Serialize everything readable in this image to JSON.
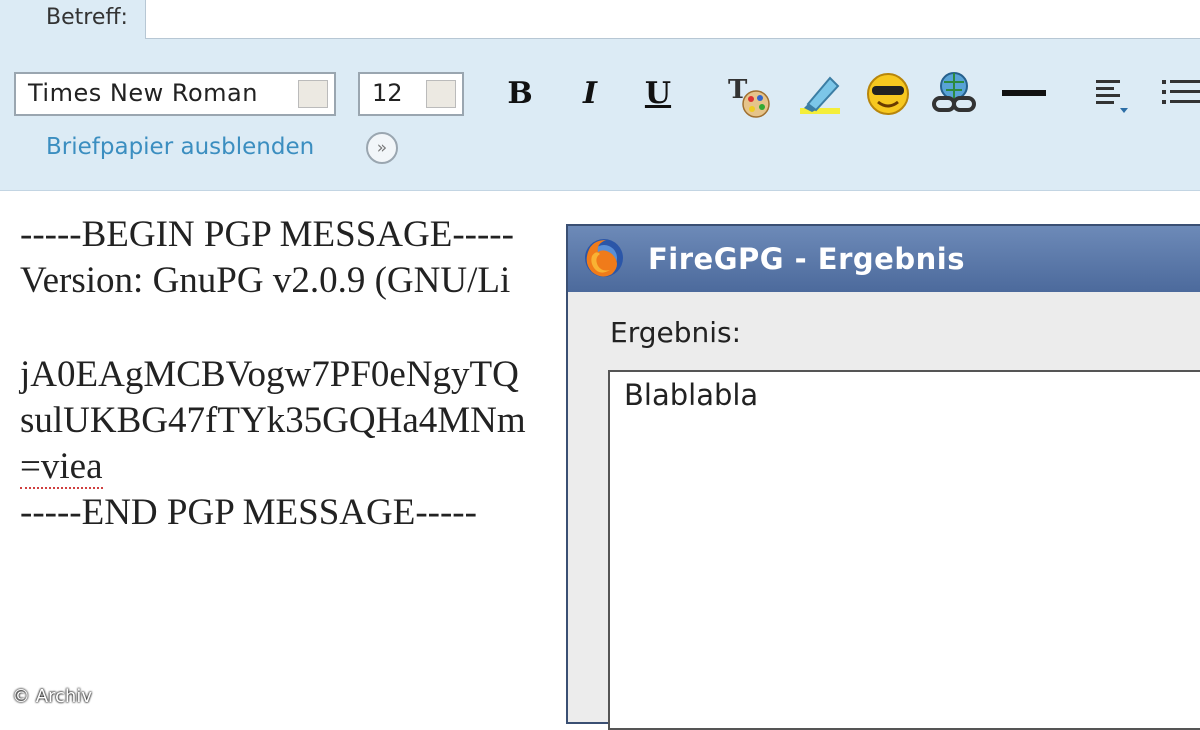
{
  "composer": {
    "subject_label": "Betreff:",
    "subject_value": "",
    "font_name": "Times New Roman",
    "font_size": "12",
    "bold_label": "B",
    "italic_label": "I",
    "underline_label": "U",
    "stationery_link": "Briefpapier ausblenden",
    "stationery_button": "»"
  },
  "editor": {
    "lines": [
      "-----BEGIN PGP MESSAGE-----",
      "Version: GnuPG v2.0.9 (GNU/Li",
      "",
      "jA0EAgMCBVogw7PF0eNgyTQ",
      "sulUKBG47fTYk35GQHa4MNm",
      "=viea",
      "-----END PGP MESSAGE-----"
    ]
  },
  "dialog": {
    "title": "FireGPG - Ergebnis",
    "result_label": "Ergebnis:",
    "result_text": "Blablabla"
  },
  "watermark": "© Archiv",
  "icons": [
    "text-color-icon",
    "highlighter-icon",
    "smiley-icon",
    "link-icon",
    "horizontal-rule-icon",
    "align-dropdown-icon",
    "list-dropdown-icon",
    "firefox-icon"
  ],
  "colors": {
    "toolbar_bg": "#dcebf5",
    "link": "#3b8ec0",
    "dialog_title": "#4c6a9c"
  }
}
